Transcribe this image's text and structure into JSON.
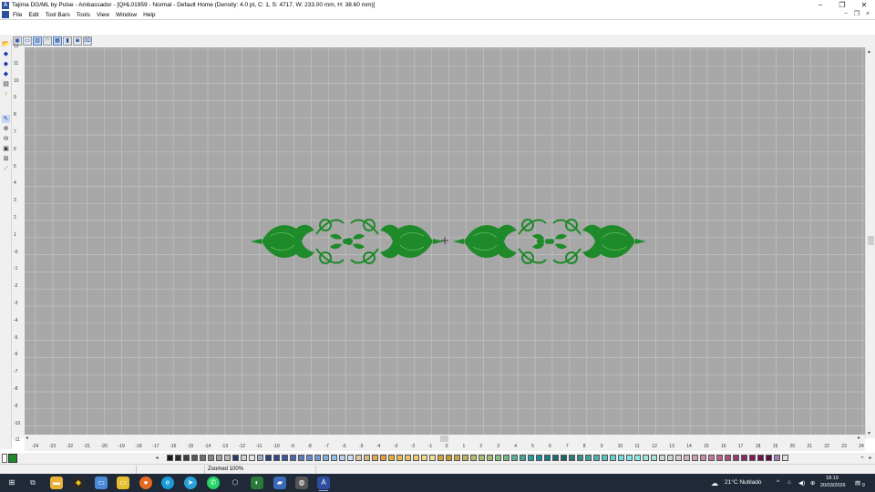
{
  "window": {
    "title": "Tajima DG/ML by Pulse - Ambassador - [QHL01959 - Normal - Default Home (Density: 4.0 pt, C: 1, S: 4717, W: 233.00 mm, H: 38.60 mm)]",
    "app_icon": "A",
    "minimize": "−",
    "restore": "❐",
    "close": "✕"
  },
  "menu": {
    "items": [
      {
        "label": "File"
      },
      {
        "label": "Edit"
      },
      {
        "label": "Tool Bars"
      },
      {
        "label": "Tools"
      },
      {
        "label": "View"
      },
      {
        "label": "Window"
      },
      {
        "label": "Help"
      }
    ],
    "mdi_minimize": "−",
    "mdi_restore": "❐",
    "mdi_close": "×"
  },
  "toolbar": {
    "buttons": [
      {
        "icon": "save-icon",
        "glyph": "▣"
      },
      {
        "icon": "monitor-icon",
        "glyph": "▭"
      },
      {
        "icon": "stitch-view-icon",
        "glyph": "▥"
      },
      {
        "icon": "hoop-icon",
        "glyph": "◠"
      },
      {
        "icon": "grid-icon",
        "glyph": "▦"
      },
      {
        "icon": "color-bars-icon",
        "glyph": "▮"
      },
      {
        "icon": "sew-simulator-icon",
        "glyph": "◙"
      },
      {
        "icon": "3d-view-icon",
        "glyph": "3D"
      }
    ]
  },
  "left_tools": [
    {
      "icon": "open-folder-icon",
      "glyph": "📂"
    },
    {
      "icon": "arrow-left-icon",
      "glyph": "◆"
    },
    {
      "icon": "arrow-up-icon",
      "glyph": "◆"
    },
    {
      "icon": "arrow-right-icon",
      "glyph": "◆"
    },
    {
      "icon": "print-icon",
      "glyph": "▤"
    },
    {
      "icon": "lightbulb-icon",
      "glyph": "♀"
    },
    {
      "icon": "select-pointer-icon",
      "glyph": "↖"
    },
    {
      "icon": "zoom-in-icon",
      "glyph": "⊕"
    },
    {
      "icon": "zoom-out-icon",
      "glyph": "⊖"
    },
    {
      "icon": "zoom-box-icon",
      "glyph": "▣"
    },
    {
      "icon": "zoom-fit-icon",
      "glyph": "⊞"
    },
    {
      "icon": "measure-icon",
      "glyph": "⟋"
    }
  ],
  "ruler_v": [
    "12",
    "11",
    "10",
    "9",
    "8",
    "7",
    "6",
    "5",
    "4",
    "3",
    "2",
    "1",
    "-0",
    "-1",
    "-2",
    "-3",
    "-4",
    "-5",
    "-6",
    "-7",
    "-8",
    "-9",
    "-10",
    "-11"
  ],
  "ruler_h": [
    "-24",
    "-23",
    "-22",
    "-21",
    "-20",
    "-19",
    "-18",
    "-17",
    "-16",
    "-15",
    "-14",
    "-13",
    "-12",
    "-11",
    "-10",
    "-9",
    "-8",
    "-7",
    "-6",
    "-5",
    "-4",
    "-3",
    "-2",
    "-1",
    "0",
    "1",
    "2",
    "3",
    "4",
    "5",
    "6",
    "7",
    "8",
    "9",
    "10",
    "11",
    "12",
    "13",
    "14",
    "15",
    "16",
    "17",
    "18",
    "19",
    "20",
    "21",
    "22",
    "23",
    "24"
  ],
  "design": {
    "thread_color": "#1f8a2a"
  },
  "palette": {
    "current_color": "#1f8a2a",
    "scroll_left": "◂",
    "scroll_right": "▸",
    "add": "+",
    "swatches": [
      "#1a1a1a",
      "#2b2b2b",
      "#3d3d3d",
      "#555555",
      "#6e6e6e",
      "#888888",
      "#a0a0a0",
      "#b8b8b8",
      "#2a3c6e",
      "#d0d0d0",
      "#e6e6e6",
      "#9fb0c8",
      "#2b3f7a",
      "#33498a",
      "#3e5a9a",
      "#4a6aaa",
      "#5a7cbc",
      "#6a8cc8",
      "#6f9bd3",
      "#82aee0",
      "#9ac0e8",
      "#b4d2f0",
      "#cde2f6",
      "#e0c9a2",
      "#d9b985",
      "#e3aa55",
      "#e0a040",
      "#e6ad3d",
      "#eab84b",
      "#edc35e",
      "#f0cd72",
      "#f2d586",
      "#f4dd9a",
      "#d5a030",
      "#c99a2b",
      "#c7a64b",
      "#c0b060",
      "#b8ba6a",
      "#a8c070",
      "#98c078",
      "#88c080",
      "#70b888",
      "#58b090",
      "#40a898",
      "#289aa0",
      "#1a8a98",
      "#1a7a8a",
      "#1e6c7c",
      "#22606e",
      "#2e7a7a",
      "#3a8a8a",
      "#46a0a0",
      "#50b0b0",
      "#5ac0c0",
      "#66d0d0",
      "#70dede",
      "#7ee6e6",
      "#8ce8e4",
      "#9ce6e0",
      "#aee0da",
      "#c0dad4",
      "#d0d4ce",
      "#d8c8c8",
      "#d4b4bc",
      "#d0a0b0",
      "#c88ca4",
      "#c07898",
      "#b8648c",
      "#a85080",
      "#983c74",
      "#882868",
      "#7a1e5c",
      "#6a1650",
      "#5a1044",
      "#a080b0",
      "#e0e0e0"
    ]
  },
  "status": {
    "zoom": "Zoomed 100%"
  },
  "taskbar": {
    "weather": "21°C  Nublado",
    "time": "18:19",
    "date": "20/03/2026",
    "notifications": "9"
  }
}
